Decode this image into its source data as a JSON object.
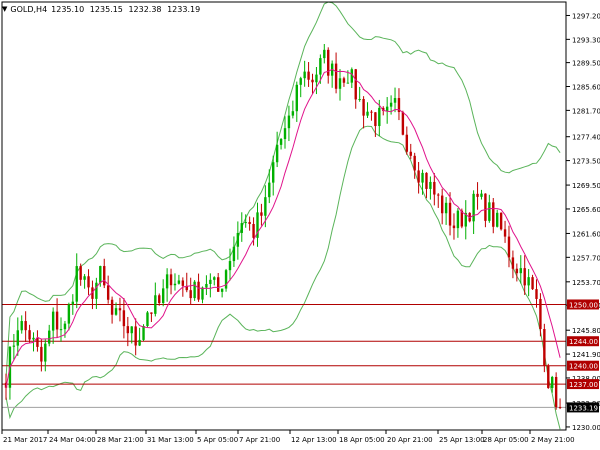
{
  "chart_header": {
    "dropdown_icon": "triangle-down-icon",
    "symbol": "GOLD,H4",
    "open": "1235.10",
    "high": "1235.15",
    "low": "1232.38",
    "close": "1233.19"
  },
  "colors": {
    "background": "#ffffff",
    "bull_candle": "#00b000",
    "bear_candle": "#c00000",
    "moving_average": "#e0148c",
    "bollinger_bands": "#5ab45a",
    "horizontal_lines": "#b00000",
    "current_price_line": "#a0a0a0",
    "level_label_bg": "#b00000",
    "current_label_bg": "#000000"
  },
  "chart_data": {
    "type": "candlestick",
    "instrument": "GOLD",
    "timeframe": "H4",
    "ylim": [
      1229.5,
      1299.4
    ],
    "price_ticks": [
      "1297.20",
      "1293.30",
      "1289.50",
      "1285.60",
      "1281.70",
      "1277.40",
      "1273.50",
      "1269.50",
      "1265.60",
      "1261.60",
      "1257.70",
      "1253.70",
      "1249.90",
      "1245.80",
      "1241.90",
      "1238.00",
      "1233.90",
      "1230.00"
    ],
    "time_ticks": [
      "21 Mar 2017",
      "24 Mar 04:00",
      "28 Mar 21:00",
      "31 Mar 13:00",
      "5 Apr 05:00",
      "7 Apr 21:00",
      "12 Apr 13:00",
      "18 Apr 05:00",
      "20 Apr 21:00",
      "25 Apr 13:00",
      "28 Apr 05:00",
      "2 May 21:00"
    ],
    "horizontal_levels": [
      "1250.00",
      "1244.00",
      "1240.00",
      "1237.00"
    ],
    "current_price": "1233.19",
    "price_path": [
      [
        0,
        1238.5
      ],
      [
        3,
        1247
      ],
      [
        6,
        1245
      ],
      [
        9,
        1240.5
      ],
      [
        12,
        1247.5
      ],
      [
        15,
        1246
      ],
      [
        18,
        1255.5
      ],
      [
        21,
        1251.5
      ],
      [
        24,
        1254.5
      ],
      [
        27,
        1248
      ],
      [
        30,
        1247
      ],
      [
        33,
        1244
      ],
      [
        36,
        1249
      ],
      [
        39,
        1250
      ],
      [
        42,
        1255
      ],
      [
        45,
        1253
      ],
      [
        48,
        1252
      ],
      [
        51,
        1254
      ],
      [
        54,
        1252
      ],
      [
        57,
        1258
      ],
      [
        60,
        1264
      ],
      [
        63,
        1262
      ],
      [
        66,
        1266
      ],
      [
        69,
        1276
      ],
      [
        72,
        1279
      ],
      [
        75,
        1288
      ],
      [
        78,
        1287
      ],
      [
        81,
        1290
      ],
      [
        84,
        1287
      ],
      [
        87,
        1288
      ],
      [
        90,
        1283
      ],
      [
        93,
        1281
      ],
      [
        96,
        1280
      ],
      [
        99,
        1282
      ],
      [
        102,
        1277
      ],
      [
        105,
        1272
      ],
      [
        108,
        1269
      ],
      [
        111,
        1266
      ],
      [
        114,
        1263
      ],
      [
        117,
        1265
      ],
      [
        120,
        1267
      ],
      [
        123,
        1265
      ],
      [
        126,
        1262
      ],
      [
        129,
        1257
      ],
      [
        132,
        1255
      ],
      [
        135,
        1250
      ],
      [
        138,
        1238
      ],
      [
        141,
        1233.2
      ]
    ],
    "indicators": [
      "Moving Average",
      "Bollinger Bands"
    ]
  }
}
